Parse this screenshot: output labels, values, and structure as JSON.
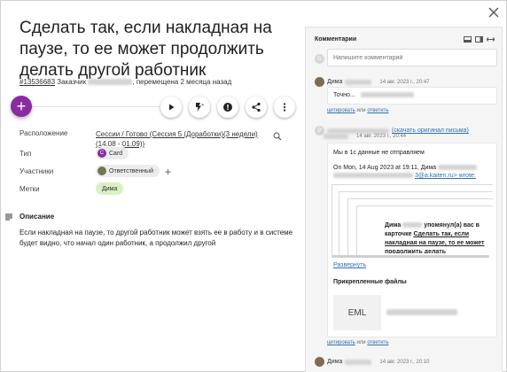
{
  "card": {
    "title": "Сделать так, если накладная на паузе, то ее может продолжить делать другой работник",
    "card_id": "#13536683",
    "meta_prefix": "Заказчик",
    "meta_suffix": ", перемещена 2 месяца назад"
  },
  "properties": {
    "location_label": "Расположение",
    "location_value": "Сессии / Готово (Сессия 5 (Доработки)(3 недели)(14.08 - 01.09))",
    "type_label": "Тип",
    "type_value": "Card",
    "type_letter": "C",
    "participants_label": "Участники",
    "participant_value": "Ответственный",
    "tags_label": "Метки",
    "tag_value": "Дима"
  },
  "description": {
    "heading": "Описание",
    "text": "Если накладная на паузе, то другой работник может взять ее в работу и в системе будет видно, что начал один работник, а продолжил другой"
  },
  "comments_panel": {
    "title": "Комментарии",
    "input_avatar_letter": "G",
    "input_placeholder": "Напишите комментарий",
    "comments": [
      {
        "author": "Дима",
        "time": "14 авг. 2023 г., 20:47",
        "text": "Точно...",
        "actions_quote": "цитировать",
        "actions_or": "или",
        "actions_reply": "ответить"
      },
      {
        "avatar_letter": "P",
        "original_link": "(скачать оригинал письма)",
        "time": "14 авг. 2023 г., 20:44",
        "line1": "Мы в 1с данные не отправляем",
        "line2": "On Mon, 14 Aug 2023 at 19:11, Дима",
        "line3_suffix": "3@a.kaiten.ru> wrote:",
        "quote_name": "Дима",
        "quote_text": "упомянул(а) вас в карточке",
        "quote_link": "Сделать так, если накладная на паузе, то ее может продолжить делать",
        "expand": "Развернуть",
        "attachments_label": "Прикрепленные файлы",
        "file_label": "EML",
        "actions_quote": "цитировать",
        "actions_or": "или",
        "actions_reply": "ответить"
      },
      {
        "author": "Дима",
        "time": "14 авг. 2023 г., 20:10"
      }
    ]
  }
}
